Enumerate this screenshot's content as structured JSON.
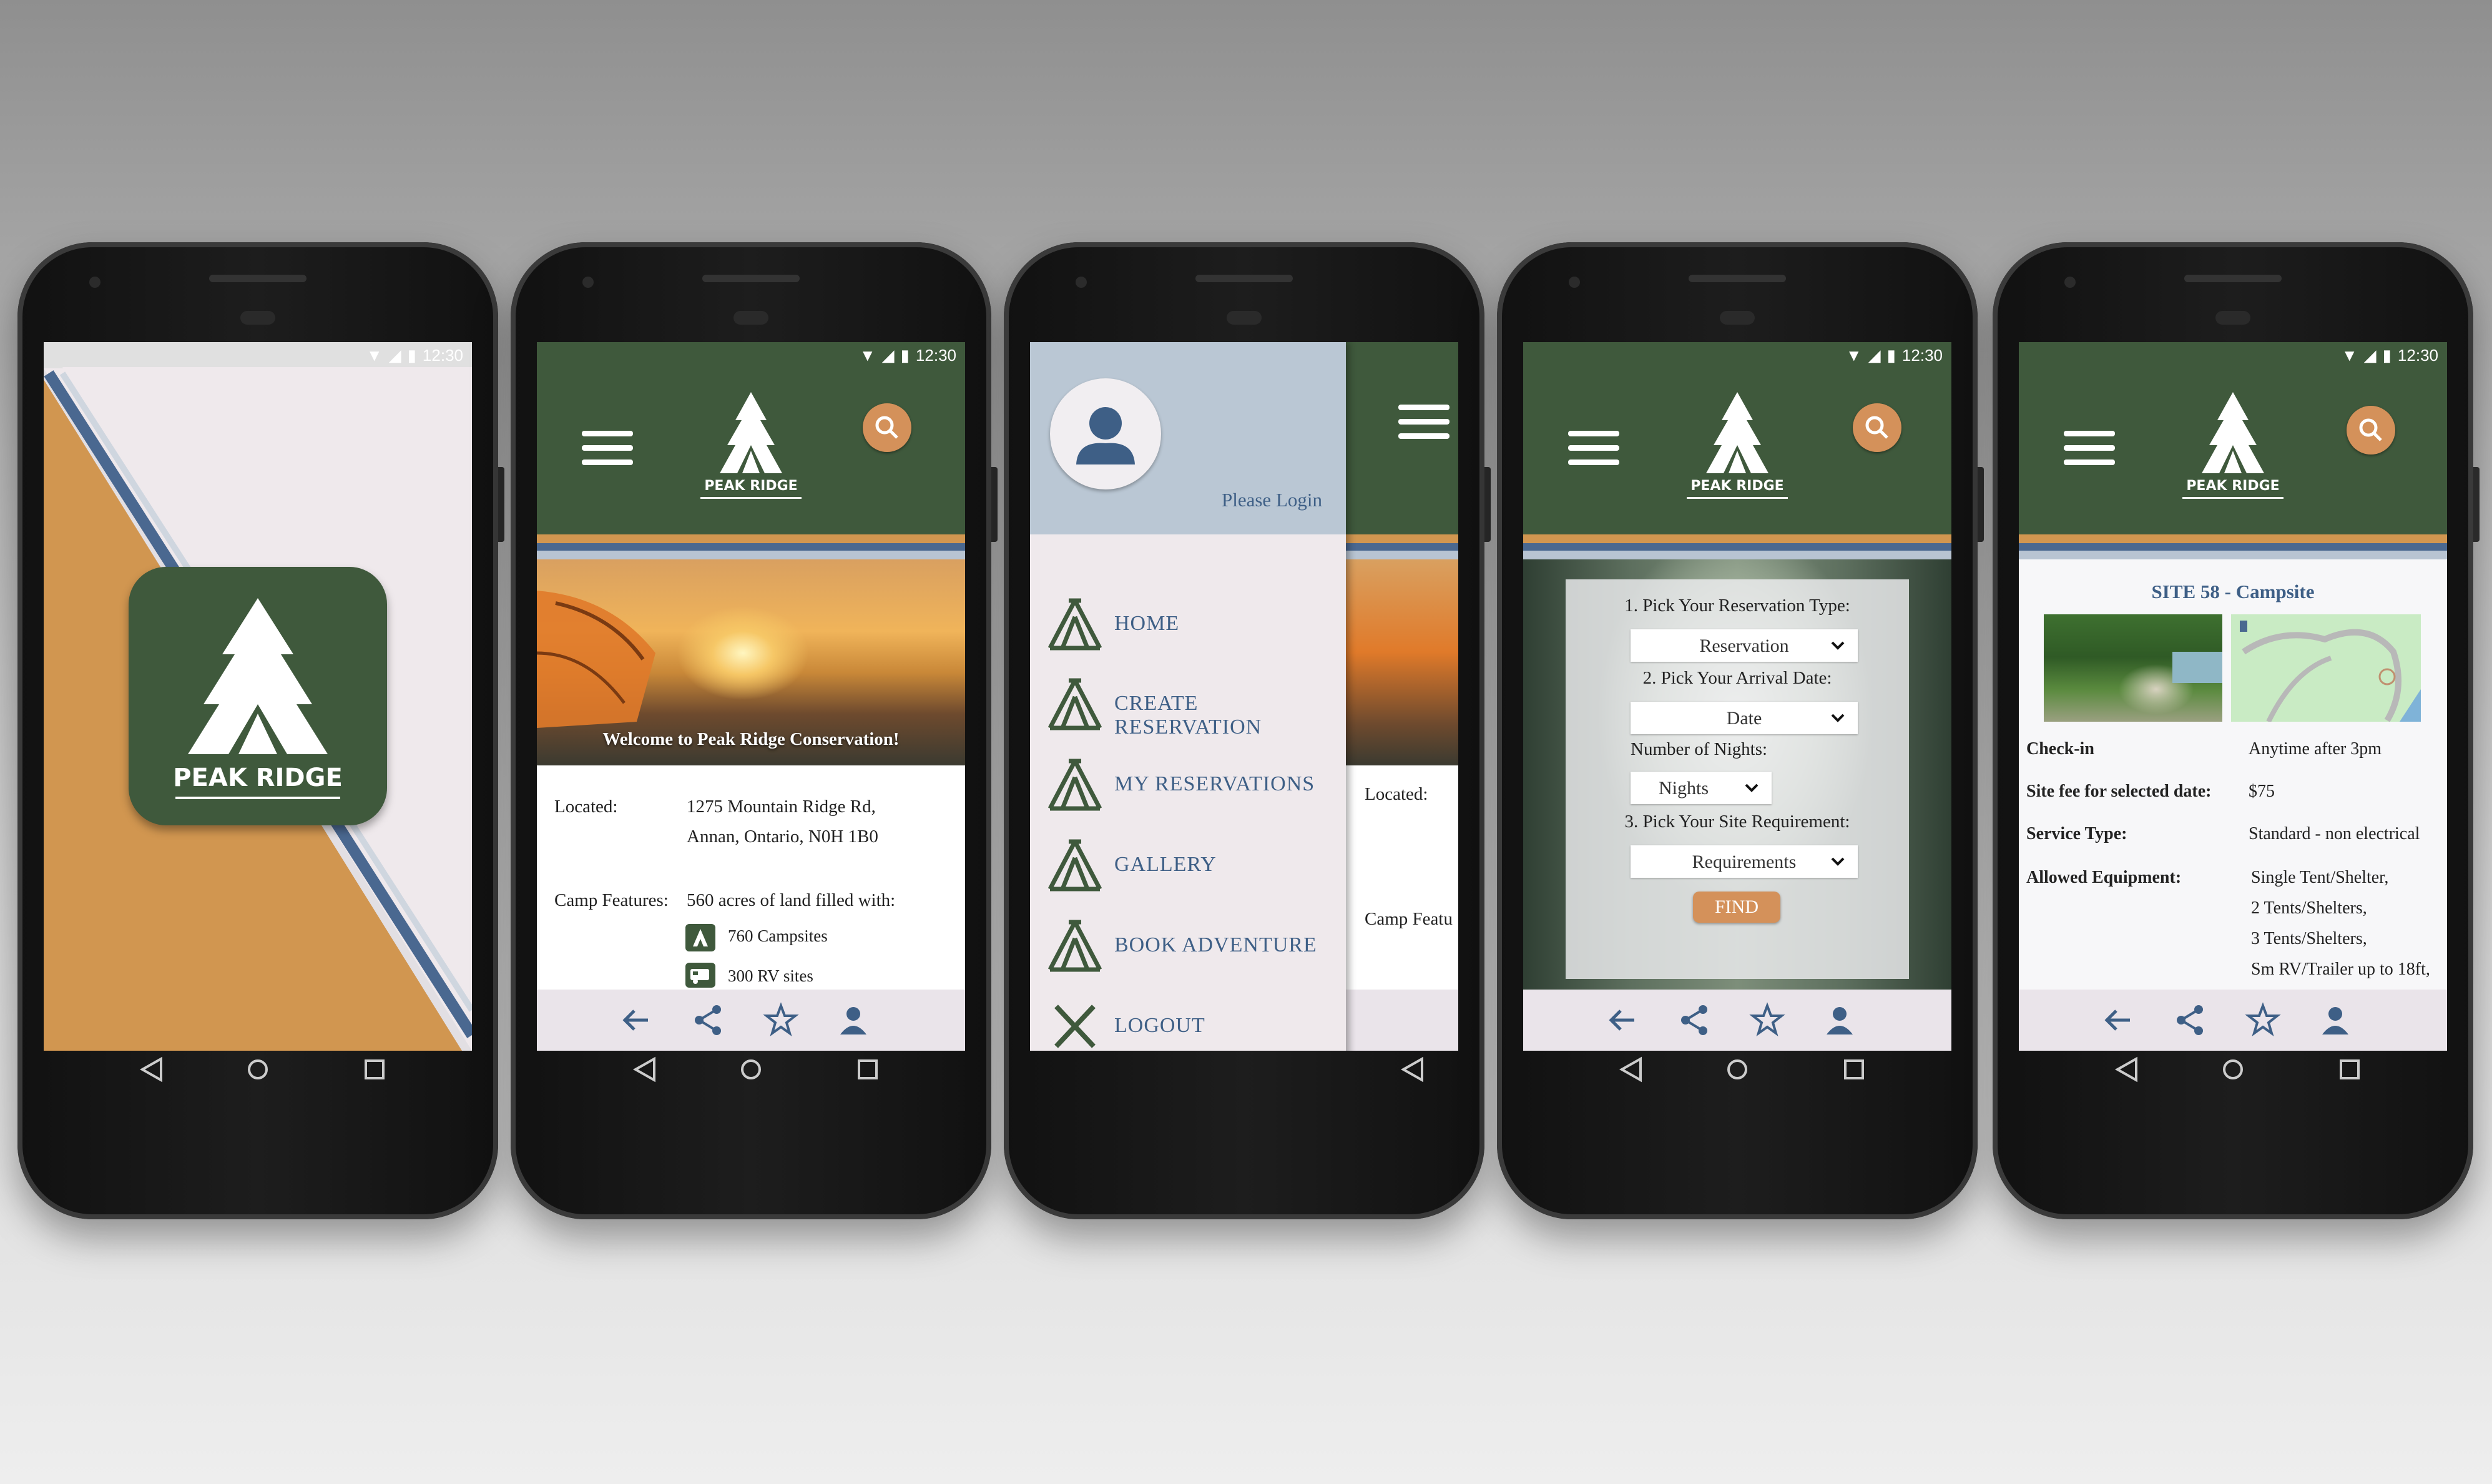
{
  "status": {
    "time": "12:30"
  },
  "brand": {
    "name": "PEAK RIDGE",
    "colors": {
      "green": "#3f593c",
      "orange": "#d19650",
      "navy": "#3e5f86"
    }
  },
  "home": {
    "welcome": "Welcome to Peak Ridge Conservation!",
    "located_label": "Located:",
    "address_line1": "1275 Mountain Ridge Rd,",
    "address_line2": "Annan, Ontario, N0H 1B0",
    "features_label": "Camp Features:",
    "features_text": "560 acres of land filled with:",
    "feature_1": "760 Campsites",
    "feature_2": "300 RV sites"
  },
  "menu": {
    "login_text": "Please Login",
    "items": [
      {
        "label": "HOME",
        "icon": "tent-icon"
      },
      {
        "label": "CREATE RESERVATION",
        "icon": "tent-icon"
      },
      {
        "label": "MY RESERVATIONS",
        "icon": "tent-icon"
      },
      {
        "label": "GALLERY",
        "icon": "tent-icon"
      },
      {
        "label": "BOOK ADVENTURE",
        "icon": "tent-icon"
      },
      {
        "label": "LOGOUT",
        "icon": "close-icon"
      }
    ],
    "peek_located": "Located:",
    "peek_features": "Camp Featu"
  },
  "reservation": {
    "step1": "1. Pick Your Reservation Type:",
    "step1_value": "Reservation",
    "step2": "2. Pick Your Arrival Date:",
    "step2_value": "Date",
    "nights_label": "Number of Nights:",
    "nights_value": "Nights",
    "step3": "3. Pick Your Site Requirement:",
    "step3_value": "Requirements",
    "find": "FIND"
  },
  "site": {
    "title": "SITE 58 - Campsite",
    "checkin_label": "Check-in",
    "checkin_value": "Anytime after 3pm",
    "fee_label": "Site fee for selected date:",
    "fee_value": "$75",
    "service_label": "Service Type:",
    "service_value": "Standard - non electrical",
    "equip_label": "Allowed Equipment:",
    "equip_values": [
      "Single Tent/Shelter,",
      "2 Tents/Shelters,",
      "3 Tents/Shelters,",
      "Sm RV/Trailer up to 18ft,"
    ]
  }
}
